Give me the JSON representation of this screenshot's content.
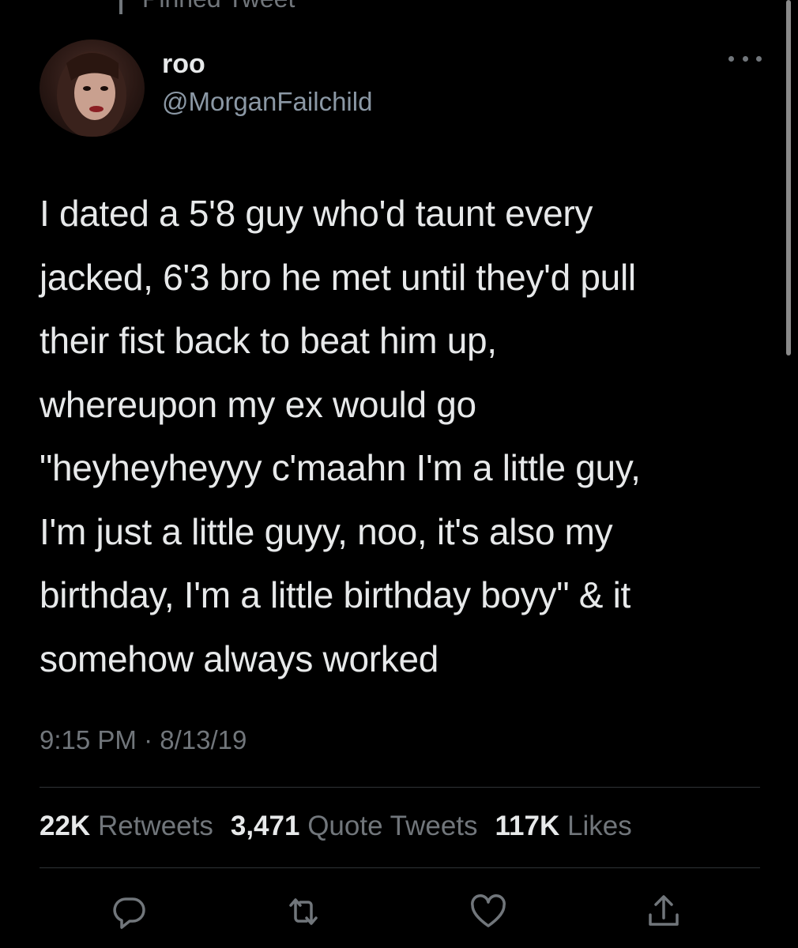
{
  "pinned_label": "Pinned Tweet",
  "author": {
    "name": "roo",
    "handle": "@MorganFailchild"
  },
  "tweet": {
    "lines": [
      "I dated a 5'8 guy who'd taunt every",
      "jacked, 6'3 bro he met until they'd pull",
      "their fist back to beat him up,",
      "whereupon my ex would go",
      "\"heyheyheyyy c'maahn I'm a little guy,",
      "I'm just a little guyy, noo, it's also my",
      "birthday, I'm a little birthday boyy\" & it",
      "somehow always worked"
    ],
    "timestamp": "9:15 PM · 8/13/19"
  },
  "stats": {
    "retweets_count": "22K",
    "retweets_label": "Retweets",
    "quotes_count": "3,471",
    "quotes_label": "Quote Tweets",
    "likes_count": "117K",
    "likes_label": "Likes"
  },
  "icons": {
    "pin": "pin-icon",
    "more": "more-icon",
    "reply": "reply-icon",
    "retweet": "retweet-icon",
    "like": "like-icon",
    "share": "share-icon"
  },
  "colors": {
    "background": "#000000",
    "primary_text": "#e7e9ea",
    "secondary_text": "#71767b",
    "divider": "#2f3336"
  }
}
